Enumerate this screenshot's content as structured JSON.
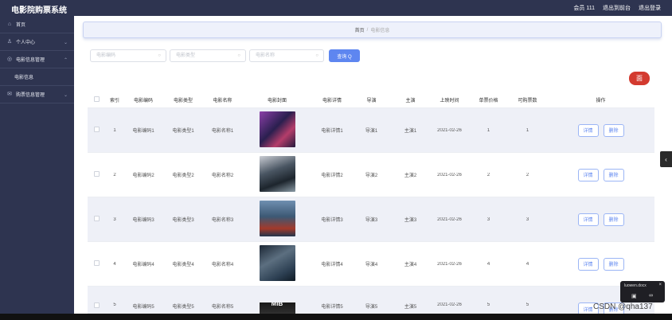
{
  "app": {
    "title": "电影院购票系统"
  },
  "header": {
    "user": "会员 111",
    "backend_link": "退出到前台",
    "logout_link": "退出登录"
  },
  "sidebar": {
    "items": [
      {
        "label": "首页",
        "icon": "home-icon"
      },
      {
        "label": "个人中心",
        "icon": "user-icon"
      },
      {
        "label": "电影信息管理",
        "icon": "film-icon"
      },
      {
        "label": "购票信息管理",
        "icon": "ticket-icon"
      }
    ],
    "subitem": "电影信息"
  },
  "breadcrumb": {
    "home": "首页",
    "separator": "/",
    "current": "电影信息"
  },
  "filters": {
    "code_placeholder": "电影编码",
    "type_placeholder": "电影类型",
    "name_placeholder": "电影名称",
    "search_label": "查询 Q"
  },
  "delete_button": "面",
  "table": {
    "headers": [
      "索引",
      "电影编码",
      "电影类型",
      "电影名称",
      "电影封面",
      "电影详情",
      "导演",
      "主演",
      "上映时间",
      "单票价格",
      "可购票数",
      "操作"
    ],
    "rows": [
      {
        "index": "1",
        "code": "电影编码1",
        "type": "电影类型1",
        "name": "电影名称1",
        "detail": "电影详情1",
        "director": "导演1",
        "actor": "主演1",
        "date": "2021-02-26",
        "price": "1",
        "count": "1"
      },
      {
        "index": "2",
        "code": "电影编码2",
        "type": "电影类型2",
        "name": "电影名称2",
        "detail": "电影详情2",
        "director": "导演2",
        "actor": "主演2",
        "date": "2021-02-26",
        "price": "2",
        "count": "2"
      },
      {
        "index": "3",
        "code": "电影编码3",
        "type": "电影类型3",
        "name": "电影名称3",
        "detail": "电影详情3",
        "director": "导演3",
        "actor": "主演3",
        "date": "2021-02-26",
        "price": "3",
        "count": "3"
      },
      {
        "index": "4",
        "code": "电影编码4",
        "type": "电影类型4",
        "name": "电影名称4",
        "detail": "电影详情4",
        "director": "导演4",
        "actor": "主演4",
        "date": "2021-02-26",
        "price": "4",
        "count": "4"
      },
      {
        "index": "5",
        "code": "电影编码5",
        "type": "电影类型5",
        "name": "电影名称5",
        "detail": "电影详情5",
        "director": "导演5",
        "actor": "主演5",
        "date": "2021-02-26",
        "price": "5",
        "count": "5"
      }
    ],
    "detail_label": "详情",
    "delete_label": "删除"
  },
  "poster5_text": "MIB",
  "widget": {
    "title": "luowen.docx"
  },
  "watermark": "CSDN @qha137",
  "colors": {
    "sidebar": "#2e3450",
    "primary": "#5e86f0",
    "danger": "#d33a2f"
  }
}
